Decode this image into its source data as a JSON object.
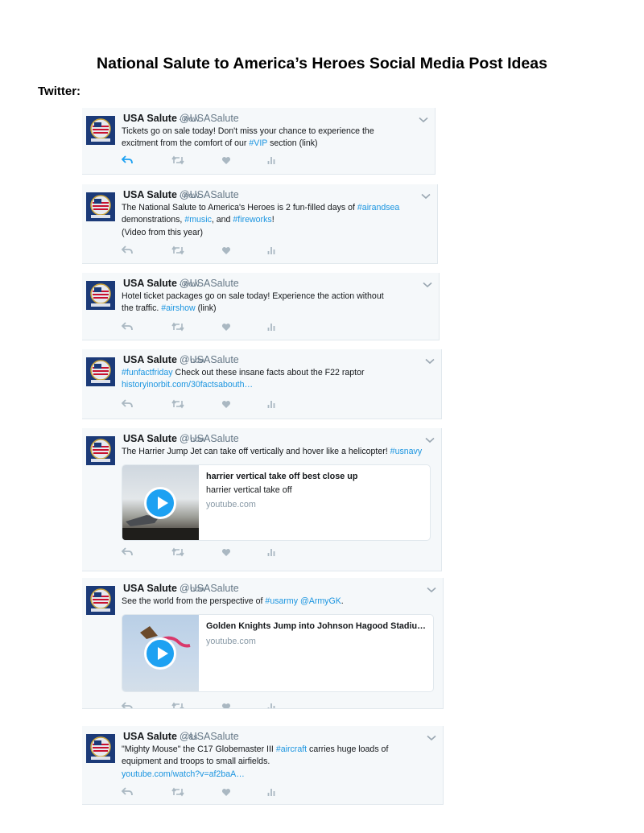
{
  "document": {
    "title": "National Salute to America’s Heroes Social Media Post Ideas",
    "section": "Twitter:"
  },
  "account": {
    "name": "USA Salute",
    "handle": "@USASalute"
  },
  "colors": {
    "link": "#1b95e0",
    "muted": "#657786",
    "card_bg": "#f5f8fa",
    "reply_active": "#1da1f2"
  },
  "icons": [
    "avatar-logo",
    "chevron-down-icon",
    "reply-icon",
    "retweet-icon",
    "like-icon",
    "analytics-icon",
    "play-icon"
  ],
  "tweets": [
    {
      "time": "· now",
      "lines": [
        [
          "Tickets go on sale today! Don't miss your chance to experience the"
        ],
        [
          "excitment from the comfort of our ",
          "#VIP",
          " section (link)"
        ]
      ]
    },
    {
      "time": "· now",
      "lines": [
        [
          "The National Salute to America's Heroes is 2 fun-filled days of ",
          "#airandsea"
        ],
        [
          "demonstrations, ",
          "#music",
          ", and ",
          "#fireworks",
          "!"
        ],
        [
          "(Video from this year)"
        ]
      ]
    },
    {
      "time": "· now",
      "lines": [
        [
          "Hotel ticket packages go on sale today! Experience the action without"
        ],
        [
          "the traffic. ",
          "#airshow",
          " (link)"
        ]
      ]
    },
    {
      "time": "· now",
      "lines": [
        [
          "",
          "#funfactfriday",
          " Check out these insane facts about the F22 raptor"
        ],
        [
          "",
          "historyinorbit.com/30factsabouth…"
        ]
      ]
    },
    {
      "time": "· now",
      "lines": [
        [
          "The Harrier Jump Jet can take off vertically and hover like a helicopter! ",
          "#usnavy"
        ]
      ],
      "card": {
        "title": "harrier vertical take off best close up",
        "description": "harrier vertical take off",
        "domain": "youtube.com"
      }
    },
    {
      "time": "· now",
      "lines": [
        [
          "See the world from the perspective of ",
          "#usarmy",
          " ",
          "@ArmyGK",
          "."
        ]
      ],
      "card": {
        "title": "Golden Knights Jump into Johnson Hagood Stadiu…",
        "description": "",
        "domain": "youtube.com"
      }
    },
    {
      "time": "· 8s",
      "lines": [
        [
          "\"Mighty Mouse\" the C17 Globemaster III ",
          "#aircraft",
          " carries huge loads of"
        ],
        [
          "equipment and troops to small airfields."
        ],
        [
          "",
          "youtube.com/watch?v=af2baA…"
        ]
      ]
    }
  ]
}
